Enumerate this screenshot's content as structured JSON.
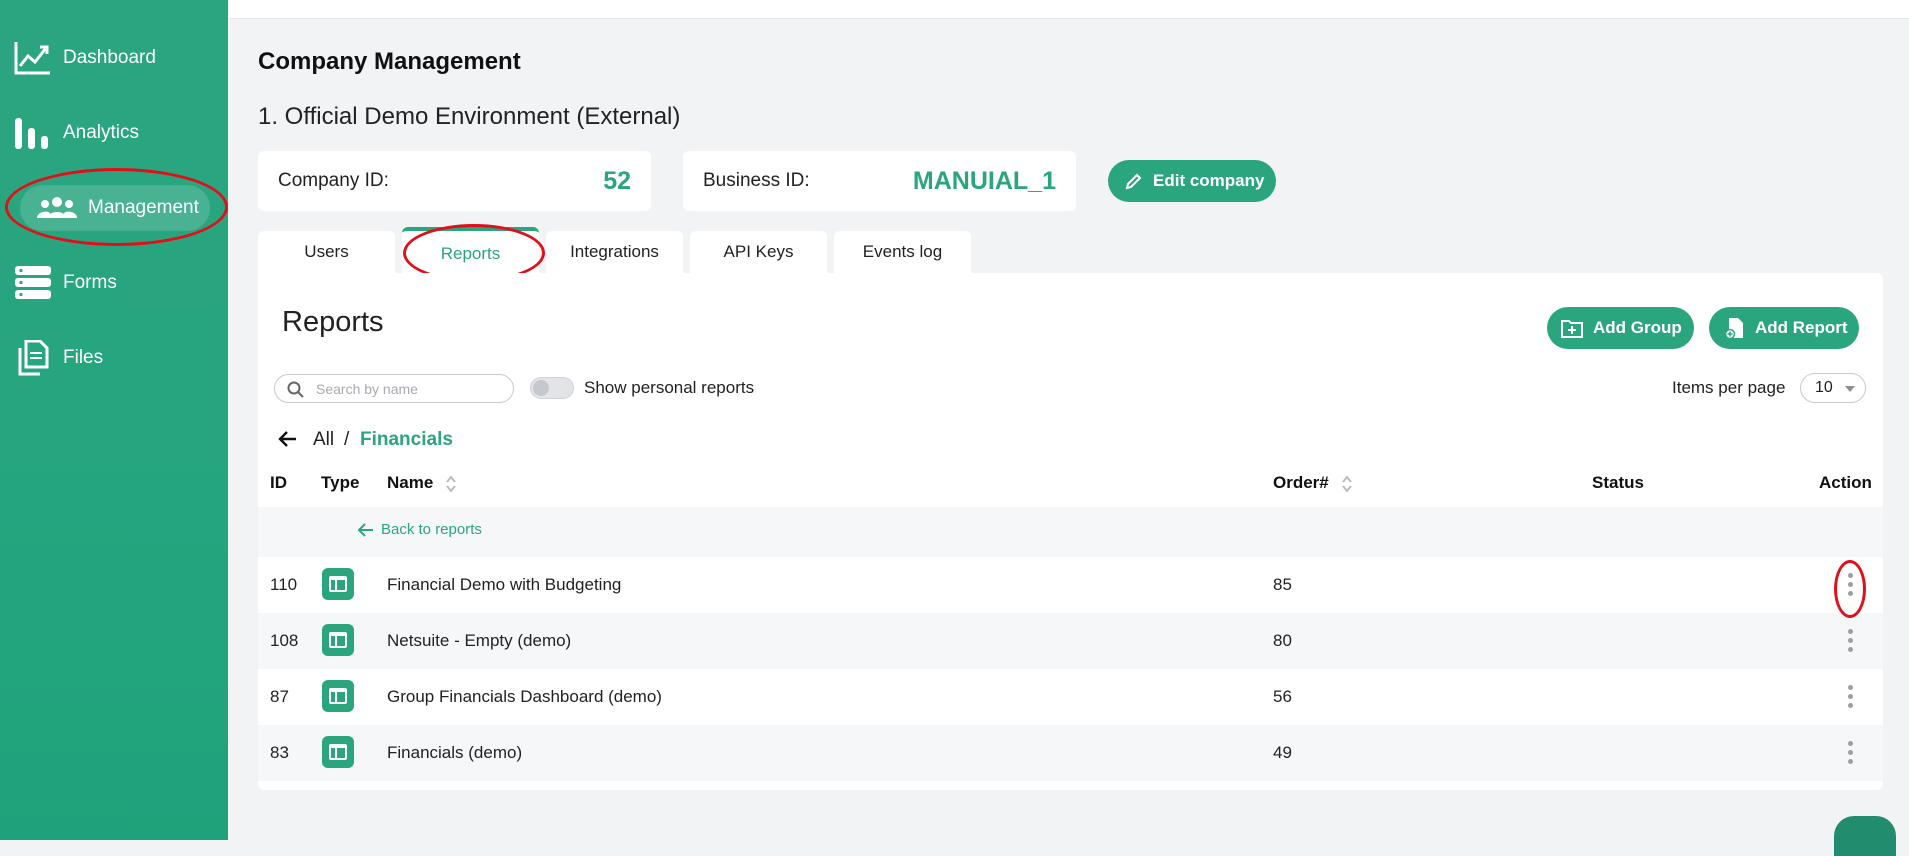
{
  "sidebar": {
    "items": [
      {
        "label": "Dashboard",
        "icon": "chart-line-icon"
      },
      {
        "label": "Analytics",
        "icon": "bar-chart-icon"
      },
      {
        "label": "Management",
        "icon": "users-icon",
        "active": true
      },
      {
        "label": "Forms",
        "icon": "server-stack-icon"
      },
      {
        "label": "Files",
        "icon": "files-icon"
      }
    ]
  },
  "header": {
    "title": "Company Management",
    "environment": "1. Official Demo Environment (External)"
  },
  "company": {
    "company_id_label": "Company ID:",
    "company_id_value": "52",
    "business_id_label": "Business ID:",
    "business_id_value": "MANUIAL_1",
    "edit_label": "Edit company"
  },
  "tabs": [
    {
      "label": "Users"
    },
    {
      "label": "Reports",
      "active": true
    },
    {
      "label": "Integrations"
    },
    {
      "label": "API Keys"
    },
    {
      "label": "Events log"
    }
  ],
  "reports": {
    "title": "Reports",
    "add_group_label": "Add Group",
    "add_report_label": "Add Report",
    "search_placeholder": "Search by name",
    "show_personal_label": "Show personal reports",
    "show_personal_on": false,
    "items_per_page_label": "Items per page",
    "items_per_page_value": "10",
    "breadcrumb": {
      "all": "All",
      "separator": "/",
      "current": "Financials"
    },
    "columns": {
      "id": "ID",
      "type": "Type",
      "name": "Name",
      "order": "Order#",
      "status": "Status",
      "action": "Action"
    },
    "back_label": "Back to reports",
    "rows": [
      {
        "id": "110",
        "name": "Financial Demo with Budgeting",
        "order": "85",
        "status": ""
      },
      {
        "id": "108",
        "name": "Netsuite - Empty (demo)",
        "order": "80",
        "status": ""
      },
      {
        "id": "87",
        "name": "Group Financials Dashboard (demo)",
        "order": "56",
        "status": ""
      },
      {
        "id": "83",
        "name": "Financials (demo)",
        "order": "49",
        "status": ""
      }
    ]
  },
  "colors": {
    "brand": "#2aa57e",
    "annotation": "#e0101a"
  }
}
